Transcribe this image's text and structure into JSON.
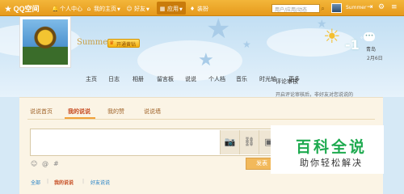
{
  "topbar": {
    "logo_text": "QQ空间",
    "nav": [
      {
        "label": "个人中心",
        "icon": "bell-icon"
      },
      {
        "label": "我的主页",
        "icon": "home-icon"
      },
      {
        "label": "好友",
        "icon": "friends-icon"
      },
      {
        "label": "应用",
        "icon": "apps-icon"
      },
      {
        "label": "装扮",
        "icon": "dressup-icon"
      }
    ],
    "search_placeholder": "用户/应用/动态",
    "user_name": "Summer",
    "colors": {
      "bar": "#f0ac2d",
      "active": "#c97b0b"
    }
  },
  "profile": {
    "username": "Summer",
    "vip_label": "开通黄钻"
  },
  "weather": {
    "temp": "-1",
    "degree": "°",
    "city": "青岛",
    "date": "2月6日"
  },
  "main_nav": [
    "主页",
    "日志",
    "相册",
    "留言板",
    "说说",
    "个人档",
    "音乐",
    "时光轴",
    "更多"
  ],
  "sub_tabs": [
    "说说首页",
    "我的说说",
    "我的赞",
    "说说墙"
  ],
  "editor": {
    "post_label": "发表",
    "tools": [
      "camera-icon",
      "link-icon",
      "video-icon"
    ]
  },
  "filters": [
    "全部",
    "我的说说",
    "好友说说"
  ],
  "sidebar": {
    "heading": "评论审核",
    "text": "开启评论审核后，非好友对您说说的"
  },
  "watermark": {
    "title": "百科全说",
    "subtitle": "助你轻松解决"
  }
}
